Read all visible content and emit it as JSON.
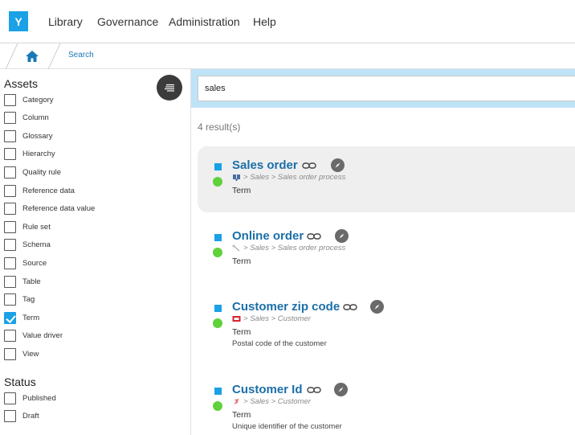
{
  "app": {
    "logo_letter": "Y"
  },
  "nav": {
    "items": [
      "Library",
      "Governance",
      "Administration",
      "Help"
    ]
  },
  "breadcrumb": {
    "current": "Search"
  },
  "sidebar": {
    "assets_title": "Assets",
    "assets": [
      {
        "label": "Category",
        "checked": false
      },
      {
        "label": "Column",
        "checked": false
      },
      {
        "label": "Glossary",
        "checked": false
      },
      {
        "label": "Hierarchy",
        "checked": false
      },
      {
        "label": "Quality rule",
        "checked": false
      },
      {
        "label": "Reference data",
        "checked": false
      },
      {
        "label": "Reference data value",
        "checked": false
      },
      {
        "label": "Rule set",
        "checked": false
      },
      {
        "label": "Schema",
        "checked": false
      },
      {
        "label": "Source",
        "checked": false
      },
      {
        "label": "Table",
        "checked": false
      },
      {
        "label": "Tag",
        "checked": false
      },
      {
        "label": "Term",
        "checked": true
      },
      {
        "label": "Value driver",
        "checked": false
      },
      {
        "label": "View",
        "checked": false
      }
    ],
    "status_title": "Status",
    "status": [
      {
        "label": "Published",
        "checked": false
      },
      {
        "label": "Draft",
        "checked": false
      }
    ]
  },
  "search": {
    "value": "sales"
  },
  "results_count": "4 result(s)",
  "results": [
    {
      "title": "Sales order",
      "path_sep": ">",
      "path_a": "Sales",
      "path_b": "Sales order process",
      "type": "Term",
      "desc": ""
    },
    {
      "title": "Online order",
      "path_sep": ">",
      "path_a": "Sales",
      "path_b": "Sales order process",
      "type": "Term",
      "desc": ""
    },
    {
      "title": "Customer zip code",
      "path_sep": ">",
      "path_a": "Sales",
      "path_b": "Customer",
      "type": "Term",
      "desc": "Postal code of the customer"
    },
    {
      "title": "Customer Id",
      "path_sep": ">",
      "path_a": "Sales",
      "path_b": "Customer",
      "type": "Term",
      "desc": "Unique identifier of the customer"
    }
  ],
  "colors": {
    "accent": "#1aa1e6",
    "link": "#1b6fa8",
    "status_ok": "#5fd13a"
  }
}
